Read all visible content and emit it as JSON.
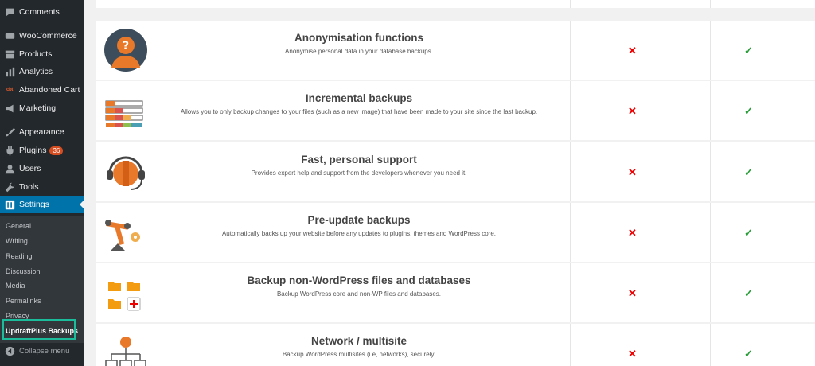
{
  "sidebar": {
    "items": [
      {
        "label": "Comments",
        "icon": "comments-icon"
      },
      {
        "label": "WooCommerce",
        "icon": "woocommerce-icon"
      },
      {
        "label": "Products",
        "icon": "products-icon"
      },
      {
        "label": "Analytics",
        "icon": "analytics-icon"
      },
      {
        "label": "Abandoned Cart",
        "icon": "abandoned-cart-logo"
      },
      {
        "label": "Marketing",
        "icon": "megaphone-icon"
      },
      {
        "label": "Appearance",
        "icon": "paintbrush-icon"
      },
      {
        "label": "Plugins",
        "icon": "plugins-icon",
        "badge": "36"
      },
      {
        "label": "Users",
        "icon": "users-icon"
      },
      {
        "label": "Tools",
        "icon": "wrench-icon"
      },
      {
        "label": "Settings",
        "icon": "settings-icon"
      }
    ],
    "abandoned_logo_text": "cbt",
    "submenu": [
      "General",
      "Writing",
      "Reading",
      "Discussion",
      "Media",
      "Permalinks",
      "Privacy",
      "UpdraftPlus Backups"
    ],
    "collapse_label": "Collapse menu",
    "active_color": "#0073aa",
    "highlight_color": "#1abc9c"
  },
  "features": [
    {
      "title": "Anonymisation functions",
      "desc": "Anonymise personal data in your database backups.",
      "free": "✕",
      "premium": "✓"
    },
    {
      "title": "Incremental backups",
      "desc": "Allows you to only backup changes to your files (such as a new image) that have been made to your site since the last backup.",
      "free": "✕",
      "premium": "✓"
    },
    {
      "title": "Fast, personal support",
      "desc": "Provides expert help and support from the developers whenever you need it.",
      "free": "✕",
      "premium": "✓"
    },
    {
      "title": "Pre-update backups",
      "desc": "Automatically backs up your website before any updates to plugins, themes and WordPress core.",
      "free": "✕",
      "premium": "✓"
    },
    {
      "title": "Backup non-WordPress files and databases",
      "desc": "Backup WordPress core and non-WP files and databases.",
      "free": "✕",
      "premium": "✓"
    },
    {
      "title": "Network / multisite",
      "desc": "Backup WordPress multisites (i.e, networks), securely.",
      "free": "✕",
      "premium": "✓"
    }
  ]
}
